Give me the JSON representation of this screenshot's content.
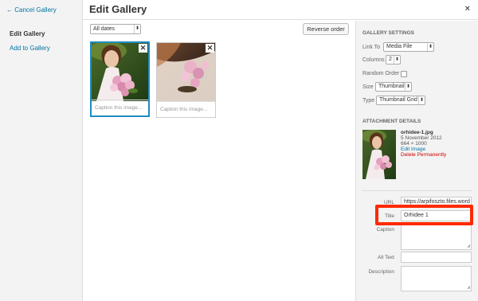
{
  "sidebar": {
    "cancel_label": "← Cancel Gallery",
    "active_label": "Edit Gallery",
    "add_label": "Add to Gallery"
  },
  "header": {
    "title": "Edit Gallery",
    "close": "×"
  },
  "toolbar": {
    "date_filter": "All dates",
    "reverse_label": "Reverse order"
  },
  "thumbs": [
    {
      "caption_placeholder": "Caption this image...",
      "remove": "✕"
    },
    {
      "caption_placeholder": "Caption this image...",
      "remove": "✕"
    }
  ],
  "gallery_settings": {
    "section_title": "GALLERY SETTINGS",
    "link_to_label": "Link To",
    "link_to_value": "Media File",
    "columns_label": "Columns",
    "columns_value": "2",
    "random_label": "Random Order",
    "size_label": "Size",
    "size_value": "Thumbnail",
    "type_label": "Type",
    "type_value": "Thumbnail Grid"
  },
  "attachment": {
    "section_title": "ATTACHMENT DETAILS",
    "filename": "orhidee-1.jpg",
    "date": "5 November 2012",
    "dimensions": "664 × 1000",
    "edit_label": "Edit Image",
    "delete_label": "Delete Permanently"
  },
  "fields": {
    "url_label": "URL",
    "url_value": "https://arpifoszto.files.word",
    "title_label": "Title",
    "title_value": "Orhidee 1",
    "caption_label": "Caption",
    "alt_label": "Alt Text",
    "description_label": "Description"
  },
  "colors": {
    "accent": "#0074a2",
    "selection": "#1e8cbe",
    "delete": "#cc0000",
    "highlight": "#ff2a00"
  }
}
